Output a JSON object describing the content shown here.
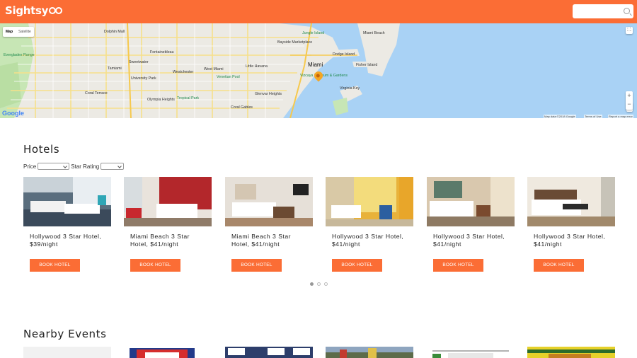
{
  "header": {
    "logo_text": "Sightsy",
    "logo_icon": "binoculars-icon",
    "search_placeholder": ""
  },
  "map": {
    "type_controls": [
      "Map",
      "Satellite"
    ],
    "city_label": "Miami",
    "labels": [
      "Dolphin Mall",
      "Fontainebleau",
      "Sweetwater",
      "Tamiami",
      "University Park",
      "Westchester",
      "West Miami",
      "Venetian Pool",
      "Olympia Heights",
      "Tropical Park",
      "Coral Gables",
      "Jungle Island",
      "Bayside Marketplace",
      "Dodge Island",
      "Miami Beach",
      "Fisher Island",
      "Vizcaya Museum & Gardens",
      "Virginia Key",
      "Little Havana",
      "Everglades Range",
      "Glenvar Heights",
      "Coral Terrace"
    ],
    "attribution": [
      "Map data ©2018 Google",
      "Terms of Use",
      "Report a map error"
    ],
    "google_logo": "Google",
    "zoom_in": "+",
    "zoom_out": "−"
  },
  "hotels": {
    "title": "Hotels",
    "filters": {
      "price_label": "Price",
      "price_value": "",
      "star_label": "Star Rating",
      "star_value": ""
    },
    "cards": [
      {
        "name": "Hollywood 3 Star Hotel, $39/night",
        "button": "BOOK HOTEL"
      },
      {
        "name": "Miami Beach 3 Star Hotel, $41/night",
        "button": "BOOK HOTEL"
      },
      {
        "name": "Miami Beach 3 Star Hotel, $41/night",
        "button": "BOOK HOTEL"
      },
      {
        "name": "Hollywood 3 Star Hotel, $41/night",
        "button": "BOOK HOTEL"
      },
      {
        "name": "Hollywood 3 Star Hotel, $41/night",
        "button": "BOOK HOTEL"
      },
      {
        "name": "Hollywood 3 Star Hotel, $41/night",
        "button": "BOOK HOTEL"
      }
    ],
    "pagination": {
      "pages": 3,
      "active": 1
    }
  },
  "events": {
    "title": "Nearby Events"
  },
  "colors": {
    "brand": "#fb6d35",
    "water": "#a9d2f5",
    "land": "#eceae4",
    "park": "#c7e6b5"
  }
}
